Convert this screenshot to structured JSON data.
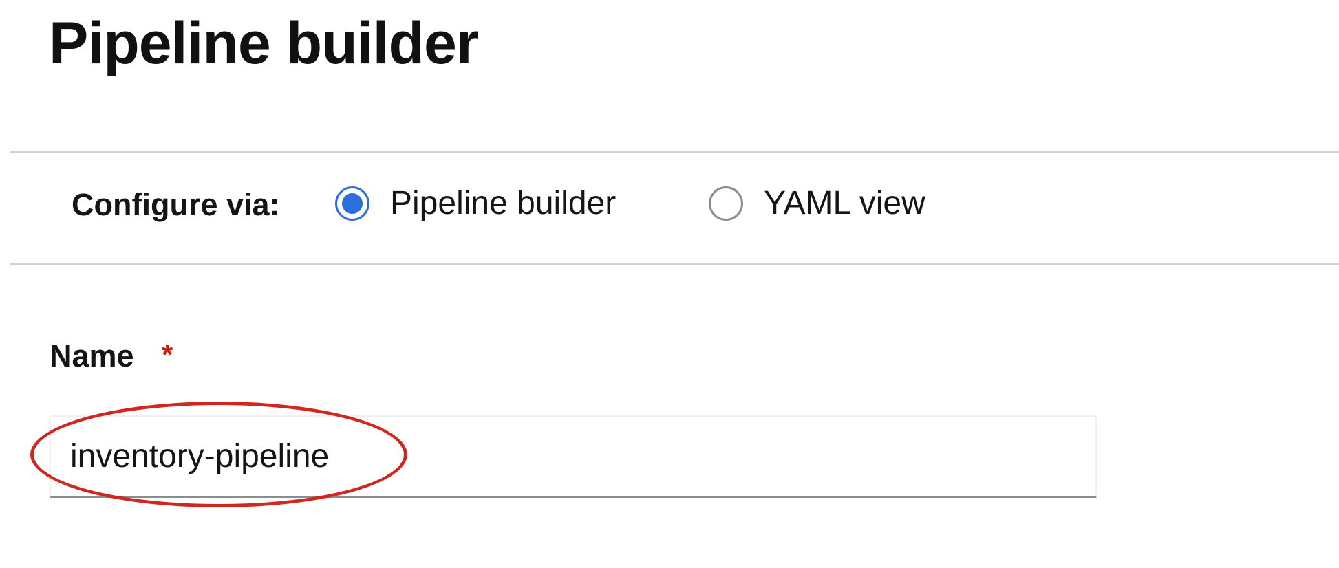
{
  "header": {
    "title": "Pipeline builder"
  },
  "configure": {
    "label": "Configure via:",
    "options": [
      {
        "label": "Pipeline builder",
        "checked": true
      },
      {
        "label": "YAML view",
        "checked": false
      }
    ]
  },
  "form": {
    "name_label": "Name",
    "required_marker": "*",
    "name_value": "inventory-pipeline"
  },
  "colors": {
    "accent": "#2b6fdd",
    "required": "#c9190b",
    "annotation": "#d0281f",
    "divider": "#d2d2d2"
  }
}
